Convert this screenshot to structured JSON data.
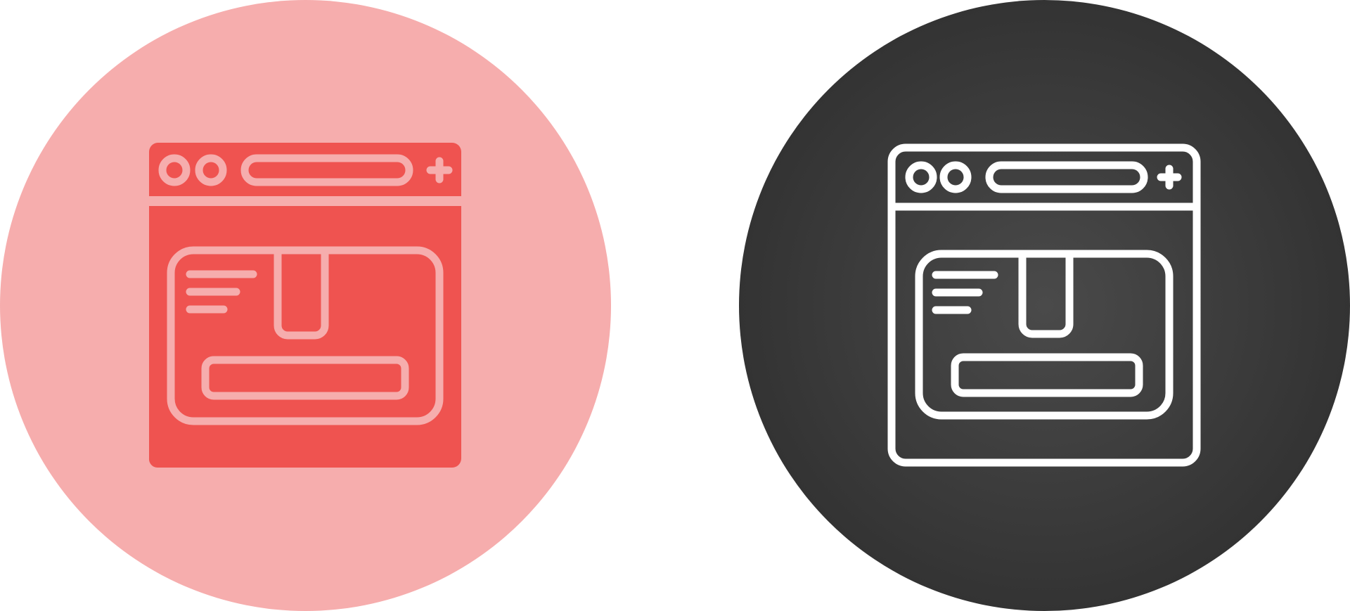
{
  "icons": [
    {
      "name": "browser-delivery-box-icon",
      "style": "filled",
      "circle_color": "#F6ADAD",
      "window_color": "#EF5350",
      "line_color": "#F6ADAD"
    },
    {
      "name": "browser-delivery-box-icon",
      "style": "outline",
      "circle_color_center": "#4A4A4A",
      "circle_color_edge": "#333333",
      "line_color": "#FFFFFF"
    }
  ]
}
